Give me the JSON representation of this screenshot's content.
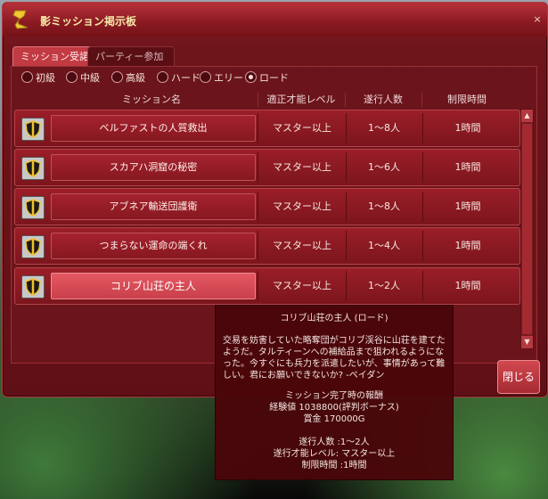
{
  "window": {
    "title": "影ミッション掲示板",
    "close_label": "×"
  },
  "tabs": [
    {
      "label": "ミッション受諾",
      "active": true
    },
    {
      "label": "パーティー参加",
      "active": false
    }
  ],
  "difficulty": {
    "options": [
      "初級",
      "中級",
      "高級",
      "ハード",
      "エリート",
      "ロード"
    ],
    "selected": "ロード"
  },
  "table": {
    "headers": [
      "ミッション名",
      "適正才能レベル",
      "遂行人数",
      "制限時間"
    ],
    "rows": [
      {
        "name": "ベルファストの人質救出",
        "level": "マスター以上",
        "players": "1〜8人",
        "time": "1時間"
      },
      {
        "name": "スカアハ洞窟の秘密",
        "level": "マスター以上",
        "players": "1〜6人",
        "time": "1時間"
      },
      {
        "name": "アブネア輸送団護衛",
        "level": "マスター以上",
        "players": "1〜8人",
        "time": "1時間"
      },
      {
        "name": "つまらない運命の端くれ",
        "level": "マスター以上",
        "players": "1〜4人",
        "time": "1時間"
      },
      {
        "name": "コリブ山荘の主人",
        "level": "マスター以上",
        "players": "1〜2人",
        "time": "1時間",
        "selected": true
      }
    ]
  },
  "close_button": "閉じる",
  "tooltip": {
    "title": "コリブ山荘の主人 (ロード)",
    "description": "交易を妨害していた略奪団がコリブ渓谷に山荘を建てたようだ。タルティーンへの補給品まで狙われるようになった。今すぐにも兵力を派遣したいが、事情があって難しい。君にお願いできないか? -ペイダン",
    "reward_heading": "ミッション完了時の報酬",
    "exp": "経験値 1038800(評判ボーナス)",
    "gold": "賞金 170000G",
    "players": "遂行人数 :1〜2人",
    "level": "遂行才能レベル: マスター以上",
    "time_limit": "制限時間 :1時間"
  },
  "colors": {
    "window_red": "#7c151d",
    "selected_row": "#d4484f",
    "title_gold": "#f7e7a8"
  }
}
